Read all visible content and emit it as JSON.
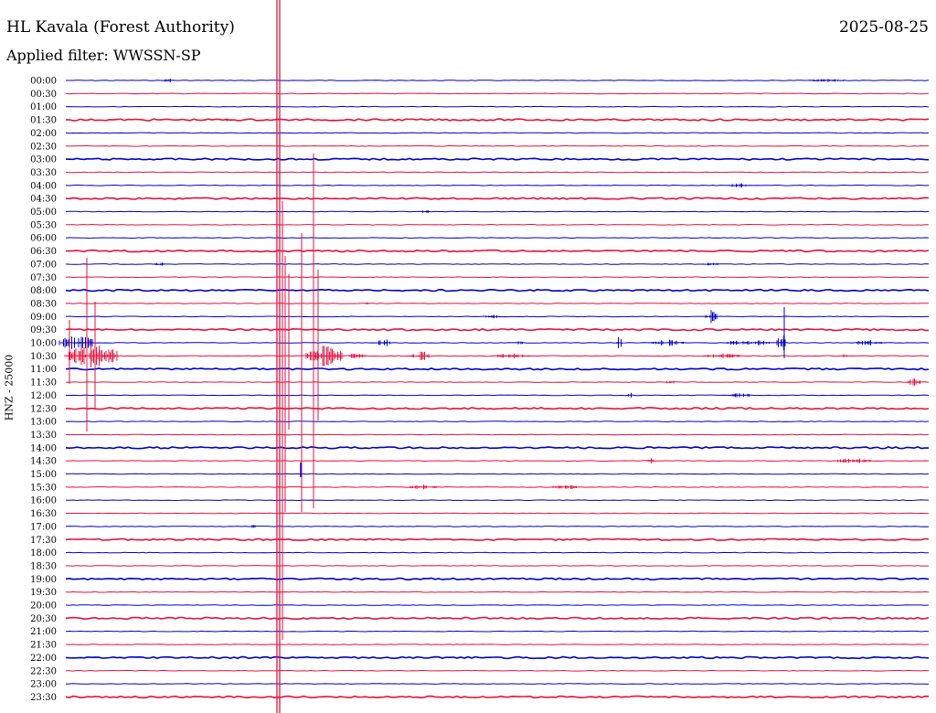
{
  "header": {
    "station": "HL Kavala (Forest Authority)",
    "date": "2025-08-25",
    "filter": "Applied filter: WWSSN-SP"
  },
  "channel_label": "HNZ - 25000",
  "colors": {
    "trace_a": "#0000cc",
    "trace_b": "#e8103c",
    "background": "#ffffff",
    "text": "#000000"
  },
  "rows": [
    "00:00",
    "00:30",
    "01:00",
    "01:30",
    "02:00",
    "02:30",
    "03:00",
    "03:30",
    "04:00",
    "04:30",
    "05:00",
    "05:30",
    "06:00",
    "06:30",
    "07:00",
    "07:30",
    "08:00",
    "08:30",
    "09:00",
    "09:30",
    "10:00",
    "10:30",
    "11:00",
    "11:30",
    "12:00",
    "12:30",
    "13:00",
    "13:30",
    "14:00",
    "14:30",
    "15:00",
    "15:30",
    "16:00",
    "16:30",
    "17:00",
    "17:30",
    "18:00",
    "18:30",
    "19:00",
    "19:30",
    "20:00",
    "20:30",
    "21:00",
    "21:30",
    "22:00",
    "22:30",
    "23:00",
    "23:30"
  ]
}
